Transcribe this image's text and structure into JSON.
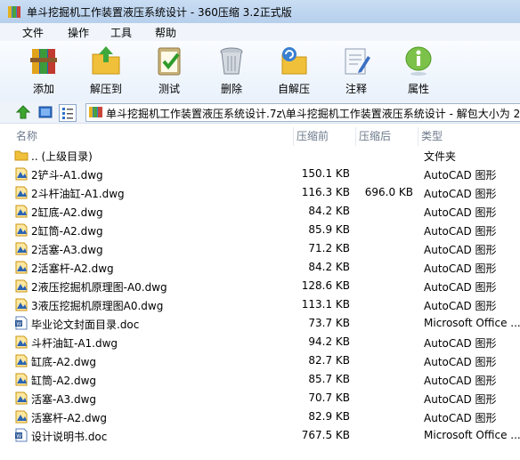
{
  "window": {
    "title": "单斗挖掘机工作装置液压系统设计 - 360压缩 3.2正式版"
  },
  "menu": [
    "文件",
    "操作",
    "工具",
    "帮助"
  ],
  "toolbar": [
    {
      "label": "添加",
      "icon": "add-archive-icon"
    },
    {
      "label": "解压到",
      "icon": "extract-to-icon"
    },
    {
      "label": "测试",
      "icon": "test-icon"
    },
    {
      "label": "删除",
      "icon": "delete-icon"
    },
    {
      "label": "自解压",
      "icon": "self-extract-icon"
    },
    {
      "label": "注释",
      "icon": "comment-icon"
    },
    {
      "label": "属性",
      "icon": "info-icon"
    }
  ],
  "address": {
    "path": "单斗挖掘机工作装置液压系统设计.7z\\单斗挖掘机工作装置液压系统设计 - 解包大小为 2"
  },
  "columns": {
    "name": "名称",
    "size": "压缩前",
    "compressed": "压缩后",
    "type": "类型"
  },
  "files": [
    {
      "name": ".. (上级目录)",
      "size": "",
      "compressed": "",
      "type": "文件夹",
      "icon": "folder"
    },
    {
      "name": "2铲斗-A1.dwg",
      "size": "150.1 KB",
      "compressed": "",
      "type": "AutoCAD 图形",
      "icon": "dwg"
    },
    {
      "name": "2斗杆油缸-A1.dwg",
      "size": "116.3 KB",
      "compressed": "696.0 KB",
      "type": "AutoCAD 图形",
      "icon": "dwg"
    },
    {
      "name": "2缸底-A2.dwg",
      "size": "84.2 KB",
      "compressed": "",
      "type": "AutoCAD 图形",
      "icon": "dwg"
    },
    {
      "name": "2缸筒-A2.dwg",
      "size": "85.9 KB",
      "compressed": "",
      "type": "AutoCAD 图形",
      "icon": "dwg"
    },
    {
      "name": "2活塞-A3.dwg",
      "size": "71.2 KB",
      "compressed": "",
      "type": "AutoCAD 图形",
      "icon": "dwg"
    },
    {
      "name": "2活塞杆-A2.dwg",
      "size": "84.2 KB",
      "compressed": "",
      "type": "AutoCAD 图形",
      "icon": "dwg"
    },
    {
      "name": "2液压挖掘机原理图-A0.dwg",
      "size": "128.6 KB",
      "compressed": "",
      "type": "AutoCAD 图形",
      "icon": "dwg"
    },
    {
      "name": "3液压挖掘机原理图A0.dwg",
      "size": "113.1 KB",
      "compressed": "",
      "type": "AutoCAD 图形",
      "icon": "dwg"
    },
    {
      "name": "毕业论文封面目录.doc",
      "size": "73.7 KB",
      "compressed": "",
      "type": "Microsoft Office ...",
      "icon": "doc"
    },
    {
      "name": "斗杆油缸-A1.dwg",
      "size": "94.2 KB",
      "compressed": "",
      "type": "AutoCAD 图形",
      "icon": "dwg"
    },
    {
      "name": "缸底-A2.dwg",
      "size": "82.7 KB",
      "compressed": "",
      "type": "AutoCAD 图形",
      "icon": "dwg"
    },
    {
      "name": "缸筒-A2.dwg",
      "size": "85.7 KB",
      "compressed": "",
      "type": "AutoCAD 图形",
      "icon": "dwg"
    },
    {
      "name": "活塞-A3.dwg",
      "size": "70.7 KB",
      "compressed": "",
      "type": "AutoCAD 图形",
      "icon": "dwg"
    },
    {
      "name": "活塞杆-A2.dwg",
      "size": "82.9 KB",
      "compressed": "",
      "type": "AutoCAD 图形",
      "icon": "dwg"
    },
    {
      "name": "设计说明书.doc",
      "size": "767.5 KB",
      "compressed": "",
      "type": "Microsoft Office ...",
      "icon": "doc"
    }
  ]
}
